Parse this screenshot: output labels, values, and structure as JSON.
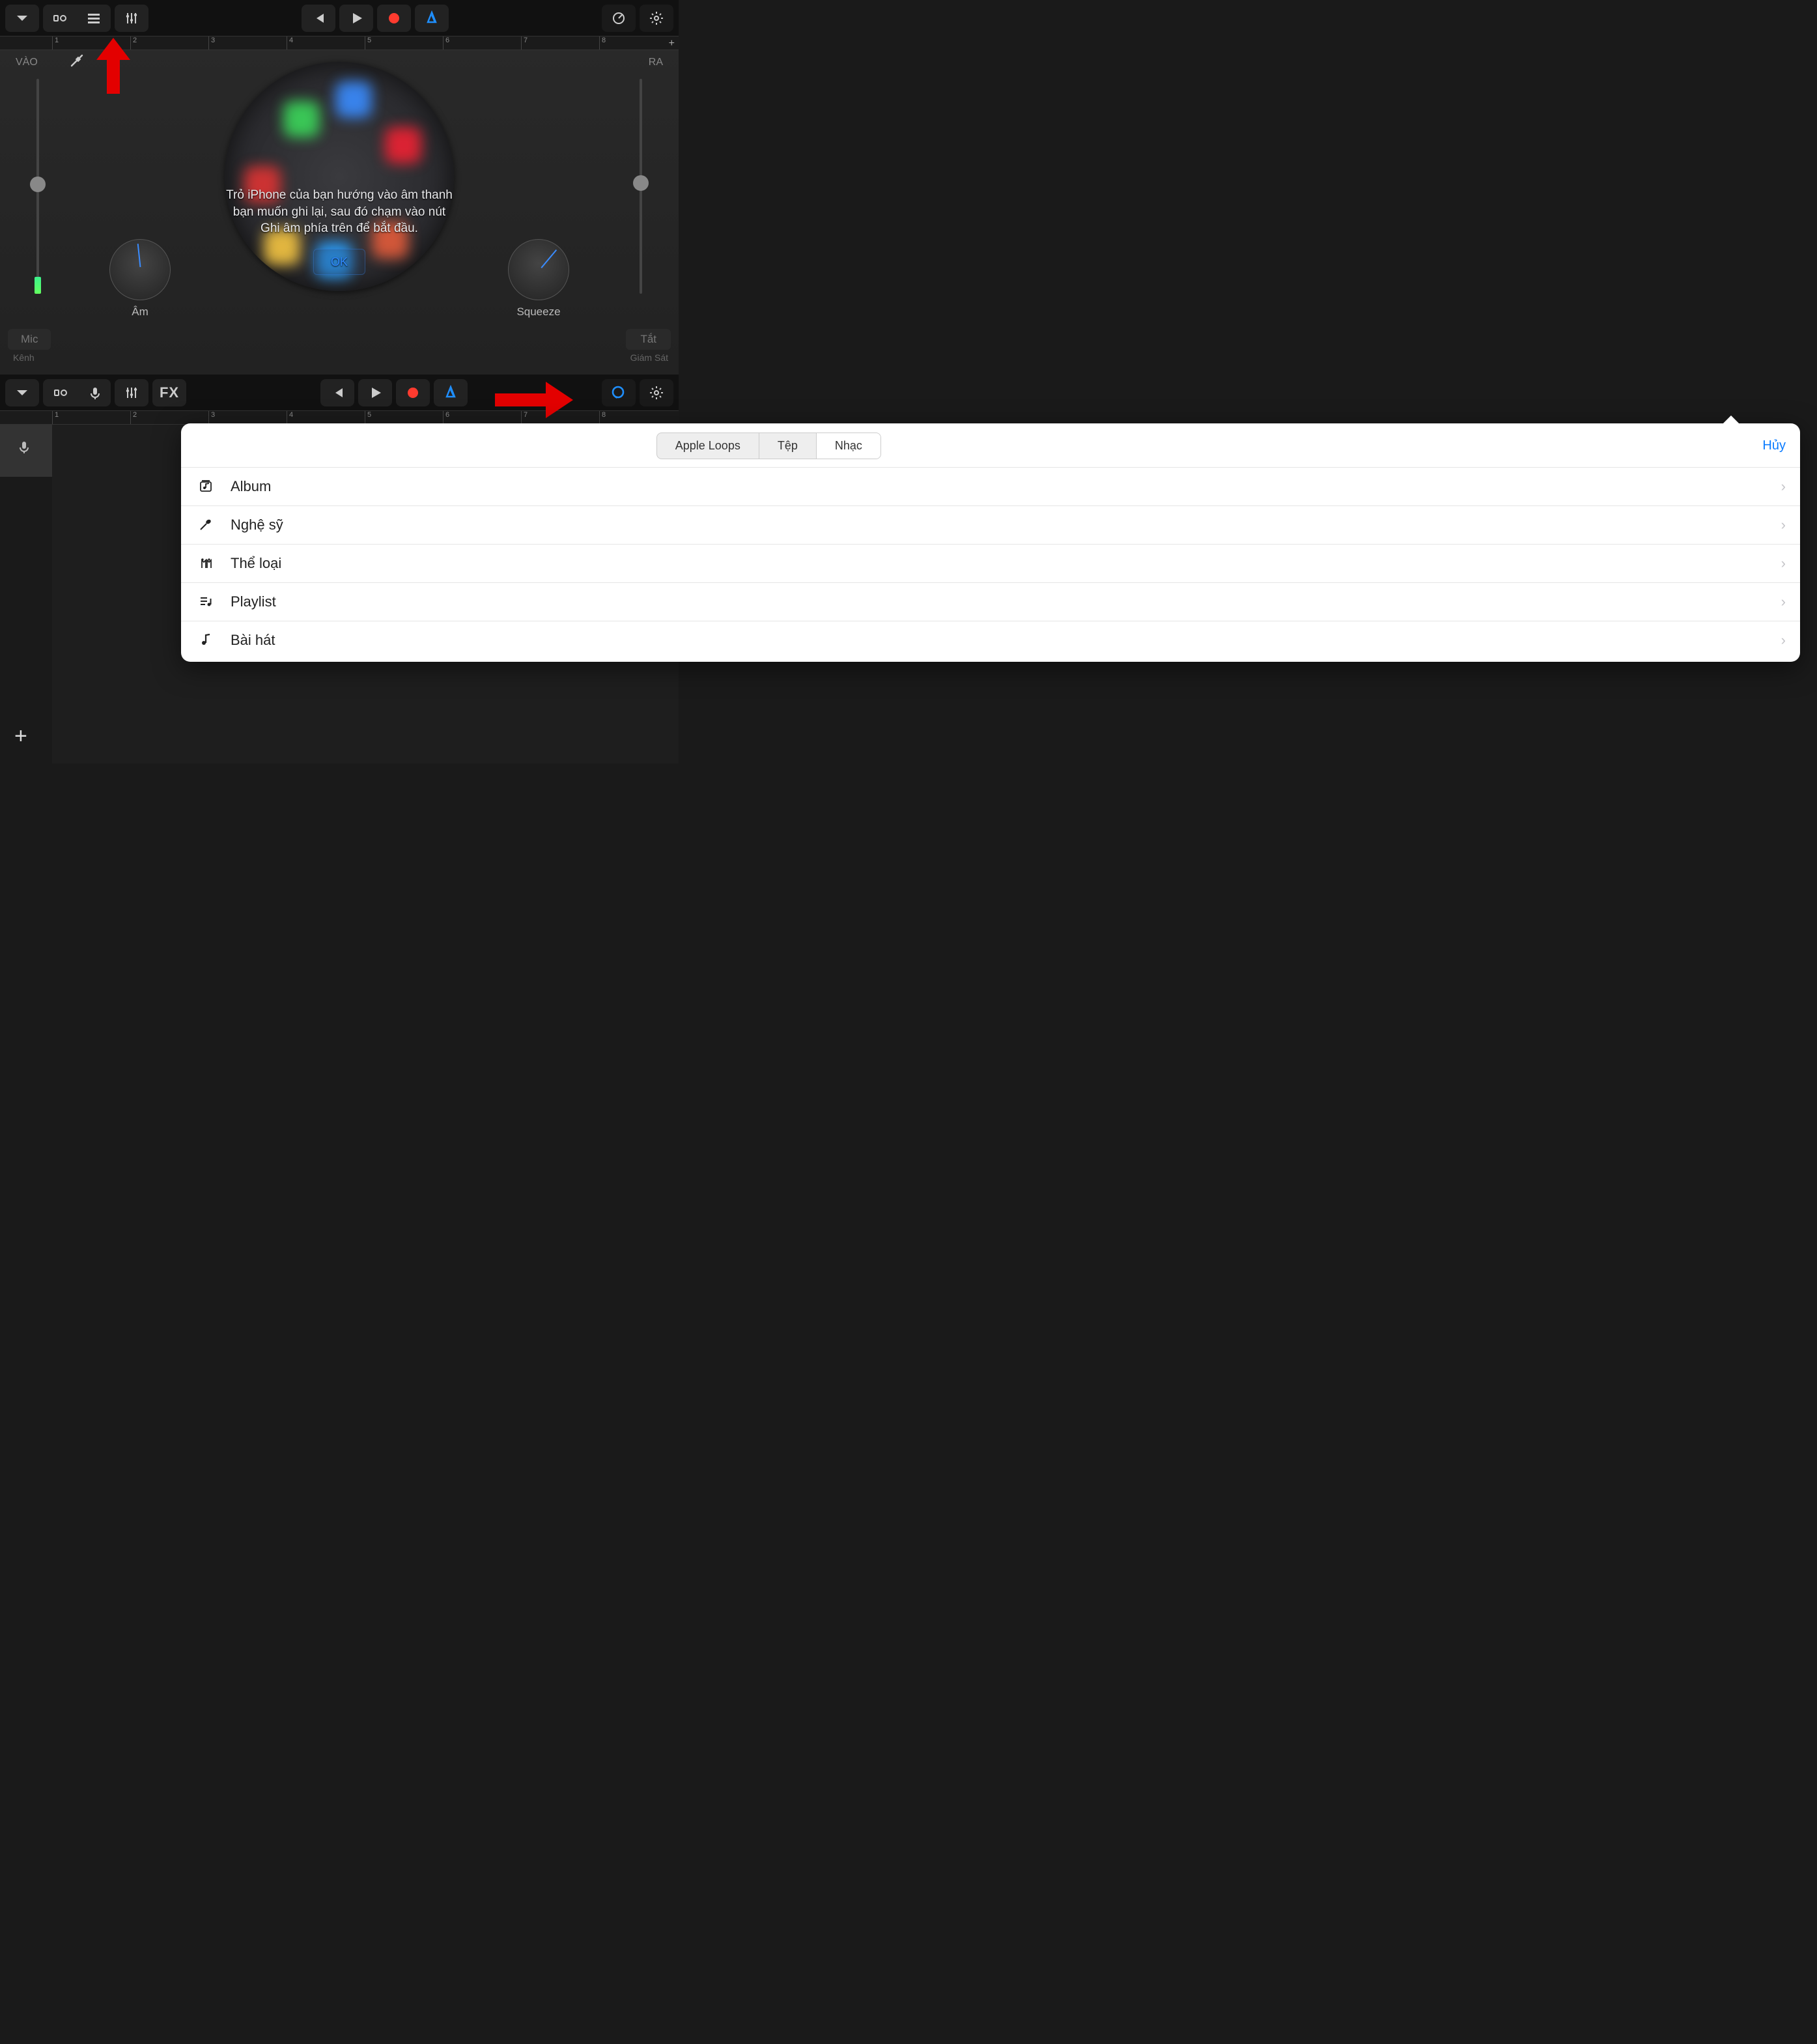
{
  "top": {
    "ruler": {
      "marks": [
        "1",
        "2",
        "3",
        "4",
        "5",
        "6",
        "7",
        "8"
      ]
    },
    "labels": {
      "in": "VÀO",
      "out": "RA"
    },
    "knob_left": "Âm",
    "knob_right": "Squeeze",
    "message": "Trỏ iPhone của bạn hướng vào âm thanh bạn muốn ghi lại, sau đó chạm vào nút Ghi âm phía trên để bắt đầu.",
    "ok": "OK",
    "mic": {
      "label": "Mic",
      "sub": "Kênh"
    },
    "monitor": {
      "label": "Tắt",
      "sub": "Giám Sát"
    }
  },
  "bottom": {
    "ruler": {
      "marks": [
        "1",
        "2",
        "3",
        "4",
        "5",
        "6",
        "7",
        "8"
      ]
    },
    "fx": "FX",
    "popover": {
      "tabs": [
        "Apple Loops",
        "Tệp",
        "Nhạc"
      ],
      "active_tab": 2,
      "cancel": "Hủy",
      "rows": [
        {
          "icon": "album",
          "label": "Album"
        },
        {
          "icon": "artist",
          "label": "Nghệ sỹ"
        },
        {
          "icon": "genre",
          "label": "Thể loại"
        },
        {
          "icon": "playlist",
          "label": "Playlist"
        },
        {
          "icon": "song",
          "label": "Bài hát"
        }
      ]
    }
  }
}
